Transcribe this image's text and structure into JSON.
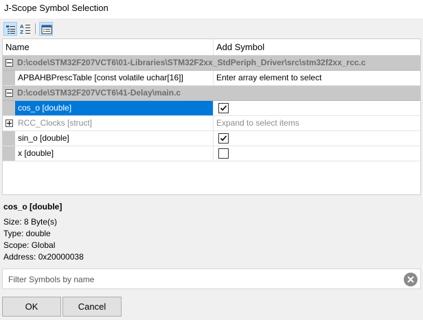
{
  "window": {
    "title": "J-Scope Symbol Selection"
  },
  "toolbar": {
    "buttons": [
      {
        "icon": "categorized-view-icon",
        "selected": true
      },
      {
        "icon": "sort-alphabetical-icon",
        "selected": false
      },
      {
        "icon": "property-pages-icon",
        "selected": true
      }
    ]
  },
  "grid": {
    "columns": {
      "name": "Name",
      "add": "Add Symbol"
    },
    "groups": [
      {
        "path": "D:\\code\\STM32F207VCT6\\01-Libraries\\STM32F2xx_StdPeriph_Driver\\src\\stm32f2xx_rcc.c",
        "expanded": true,
        "items": [
          {
            "name": "APBAHBPrescTable [const volatile uchar[16]]",
            "value_text": "Enter array element to select"
          }
        ]
      },
      {
        "path": "D:\\code\\STM32F207VCT6\\41-Delay\\main.c",
        "expanded": true,
        "items": [
          {
            "name": "cos_o [double]",
            "checked": true,
            "selected": true
          },
          {
            "name": "RCC_Clocks [struct]",
            "value_text": "Expand to select items",
            "expandable": true
          },
          {
            "name": "sin_o [double]",
            "checked": true
          },
          {
            "name": "x [double]",
            "checked": false
          }
        ]
      }
    ]
  },
  "details": {
    "title": "cos_o [double]",
    "size": "Size:  8 Byte(s)",
    "type": "Type:  double",
    "scope": "Scope:  Global",
    "address": "Address: 0x20000038"
  },
  "filter": {
    "placeholder": "Filter Symbols by name",
    "value": ""
  },
  "buttons": {
    "ok": "OK",
    "cancel": "Cancel"
  },
  "colors": {
    "selection": "#0078d7",
    "group_bg": "#c8c8c8",
    "muted_text": "#8c8c8c"
  }
}
